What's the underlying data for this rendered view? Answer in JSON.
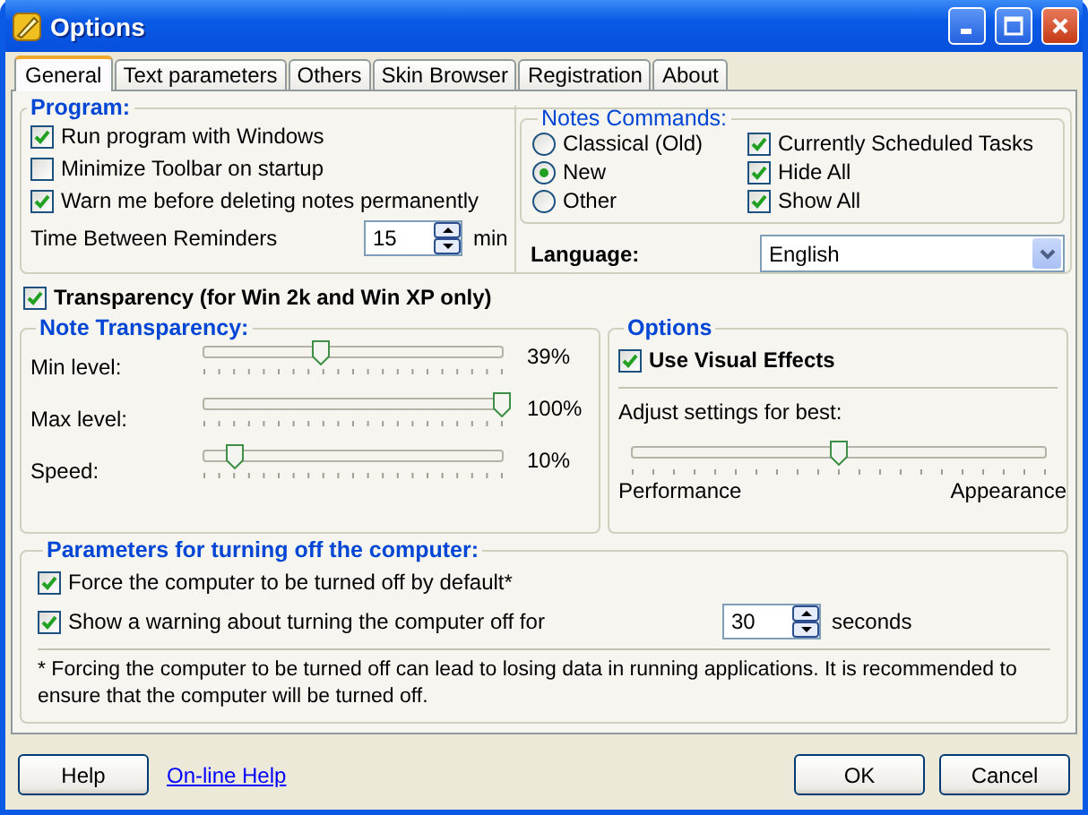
{
  "window": {
    "title": "Options"
  },
  "tabs": [
    {
      "label": "General",
      "selected": true
    },
    {
      "label": "Text parameters",
      "selected": false
    },
    {
      "label": "Others",
      "selected": false
    },
    {
      "label": "Skin Browser",
      "selected": false
    },
    {
      "label": "Registration",
      "selected": false
    },
    {
      "label": "About",
      "selected": false
    }
  ],
  "program": {
    "title": "Program:",
    "options": [
      {
        "label": "Run program with Windows",
        "checked": true
      },
      {
        "label": "Minimize Toolbar on startup",
        "checked": false
      },
      {
        "label": "Warn me before deleting notes permanently",
        "checked": true
      }
    ],
    "reminder": {
      "label": "Time Between Reminders",
      "value": "15",
      "unit": "min"
    }
  },
  "notes_commands": {
    "title": "Notes Commands:",
    "modes": [
      {
        "label": "Classical (Old)",
        "selected": false
      },
      {
        "label": "New",
        "selected": true
      },
      {
        "label": "Other",
        "selected": false
      }
    ],
    "options": [
      {
        "label": "Currently Scheduled Tasks",
        "checked": true
      },
      {
        "label": "Hide All",
        "checked": true
      },
      {
        "label": "Show All",
        "checked": true
      }
    ]
  },
  "language": {
    "label": "Language:",
    "value": "English"
  },
  "transparency": {
    "label": "Transparency (for Win 2k and Win XP only)",
    "checked": true
  },
  "note_transparency": {
    "title": "Note Transparency:",
    "sliders": [
      {
        "label": "Min level:",
        "level": 0.39,
        "reading": "39%"
      },
      {
        "label": "Max level:",
        "level": 1.0,
        "reading": "100%"
      },
      {
        "label": "Speed:",
        "level": 0.1,
        "reading": "10%"
      }
    ]
  },
  "options": {
    "title": "Options",
    "visual_effects": {
      "label": "Use Visual Effects",
      "checked": true
    },
    "adjust_label": "Adjust settings for best:",
    "level": 0.5,
    "min_label": "Performance",
    "max_label": "Appearance"
  },
  "shutdown": {
    "title": "Parameters for turning off the computer:",
    "options": [
      {
        "label": "Force the computer to be turned off by default*",
        "checked": true
      },
      {
        "label": "Show a warning about turning the computer off for",
        "checked": true,
        "delay": {
          "value": "30",
          "unit": "seconds"
        }
      }
    ],
    "note": "* Forcing the computer to be turned off can lead to losing data in running applications. It is recommended to ensure that the computer will be turned off."
  },
  "buttons": {
    "help": "Help",
    "online_help": "On-line Help",
    "ok": "OK",
    "cancel": "Cancel"
  }
}
